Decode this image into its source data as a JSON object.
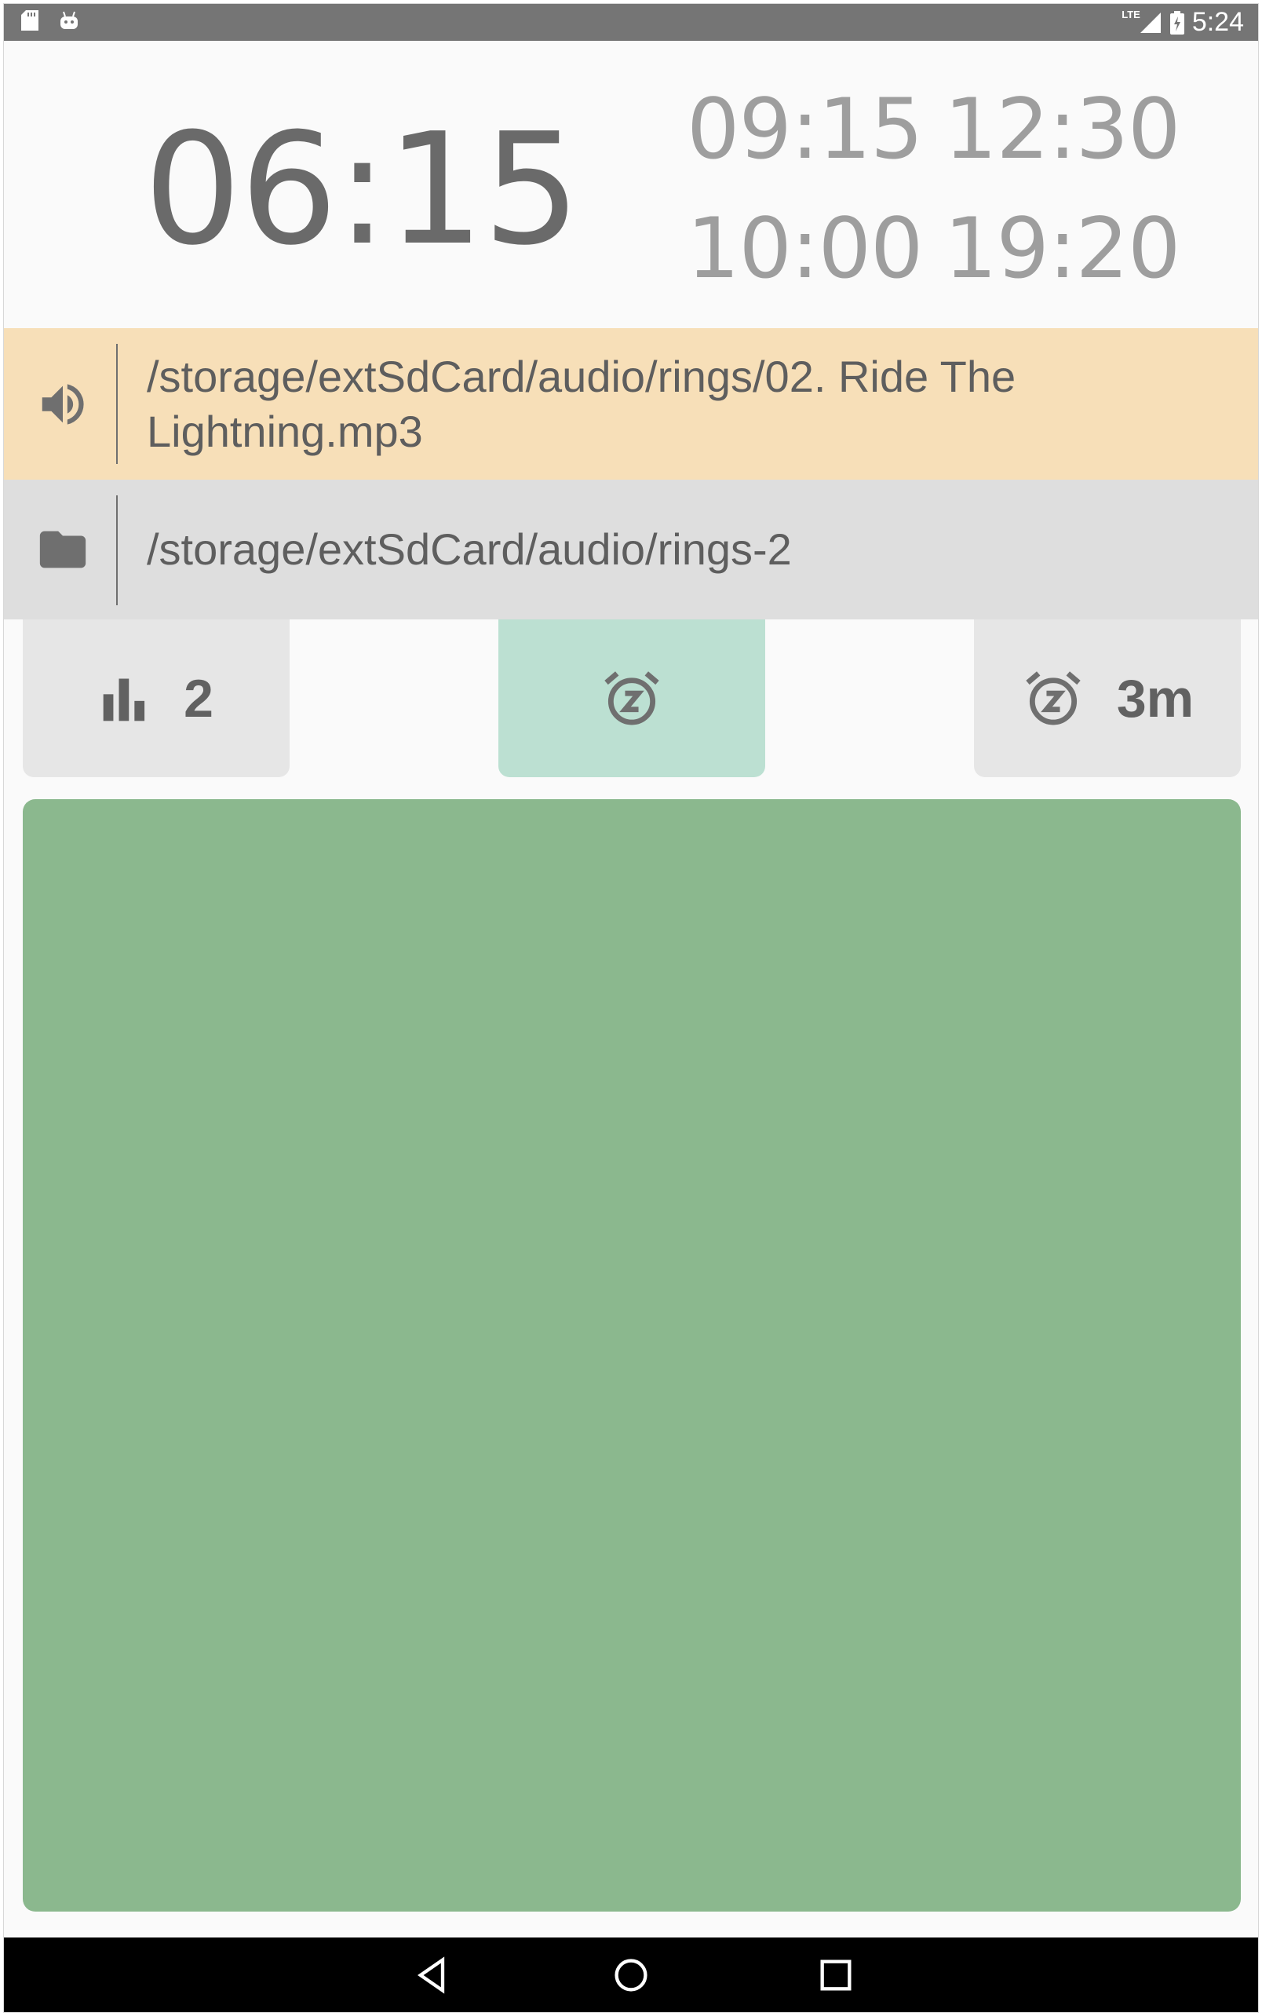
{
  "status_bar": {
    "time": "5:24",
    "network": "LTE",
    "icons": [
      "sd-card-icon",
      "android-icon",
      "signal-icon",
      "battery-charging-icon"
    ]
  },
  "clock": {
    "main_time": "06:15",
    "other_times": [
      "09:15",
      "12:30",
      "10:00",
      "19:20"
    ]
  },
  "ringtone": {
    "icon": "volume-icon",
    "path": "/storage/extSdCard/audio/rings/02. Ride The Lightning.mp3"
  },
  "folder": {
    "icon": "folder-icon",
    "path": "/storage/extSdCard/audio/rings-2"
  },
  "buttons": {
    "stats": {
      "icon": "bar-chart-icon",
      "label": "2"
    },
    "snooze": {
      "icon": "snooze-alarm-icon"
    },
    "snooze_time": {
      "icon": "snooze-alarm-icon",
      "label": "3m"
    }
  },
  "colors": {
    "ringtone_bg": "#f7dfb8",
    "folder_bg": "#dedede",
    "snooze_bg": "#bce0d2",
    "dismiss_bg": "#8bb88e"
  },
  "nav": [
    "back-icon",
    "home-icon",
    "recents-icon"
  ]
}
